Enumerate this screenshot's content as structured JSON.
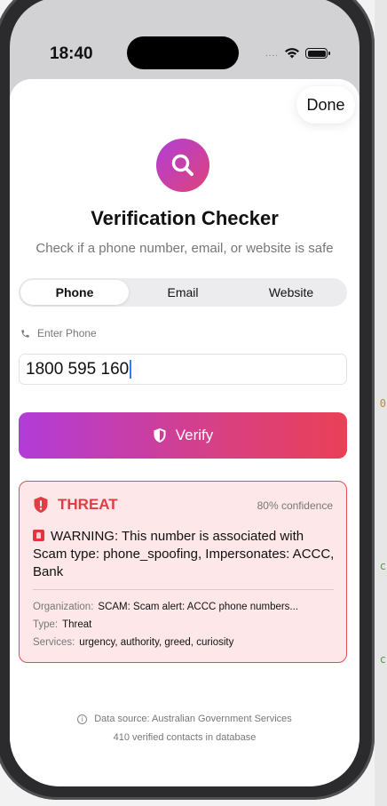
{
  "status_bar": {
    "time": "18:40",
    "dots": "....",
    "icons": [
      "wifi-icon",
      "battery-icon"
    ]
  },
  "header": {
    "done_label": "Done",
    "title": "Verification Checker",
    "subtitle": "Check if a phone number, email, or website is safe",
    "icon": "search-icon"
  },
  "tabs": [
    {
      "label": "Phone",
      "active": true
    },
    {
      "label": "Email",
      "active": false
    },
    {
      "label": "Website",
      "active": false
    }
  ],
  "input": {
    "label": "Enter Phone",
    "value": "1800 595 160",
    "icon": "phone-icon"
  },
  "verify_button": {
    "label": "Verify",
    "icon": "shield-icon"
  },
  "result": {
    "status": "THREAT",
    "confidence": "80% confidence",
    "warning": "WARNING: This number is associated with Scam type: phone_spoofing, Impersonates: ACCC, Bank",
    "details": [
      {
        "key": "Organization:",
        "value": "SCAM: Scam alert: ACCC phone numbers..."
      },
      {
        "key": "Type:",
        "value": "Threat"
      },
      {
        "key": "Services:",
        "value": "urgency, authority, greed, curiosity"
      }
    ]
  },
  "footer": {
    "source": "Data source: Australian Government Services",
    "count": "410 verified contacts in database"
  },
  "side_glyphs": [
    "0",
    "c",
    "c"
  ],
  "colors": {
    "accent_start": "#b23cd8",
    "accent_end": "#ea4057",
    "threat": "#e03e44",
    "threat_bg": "#fde7e8"
  }
}
